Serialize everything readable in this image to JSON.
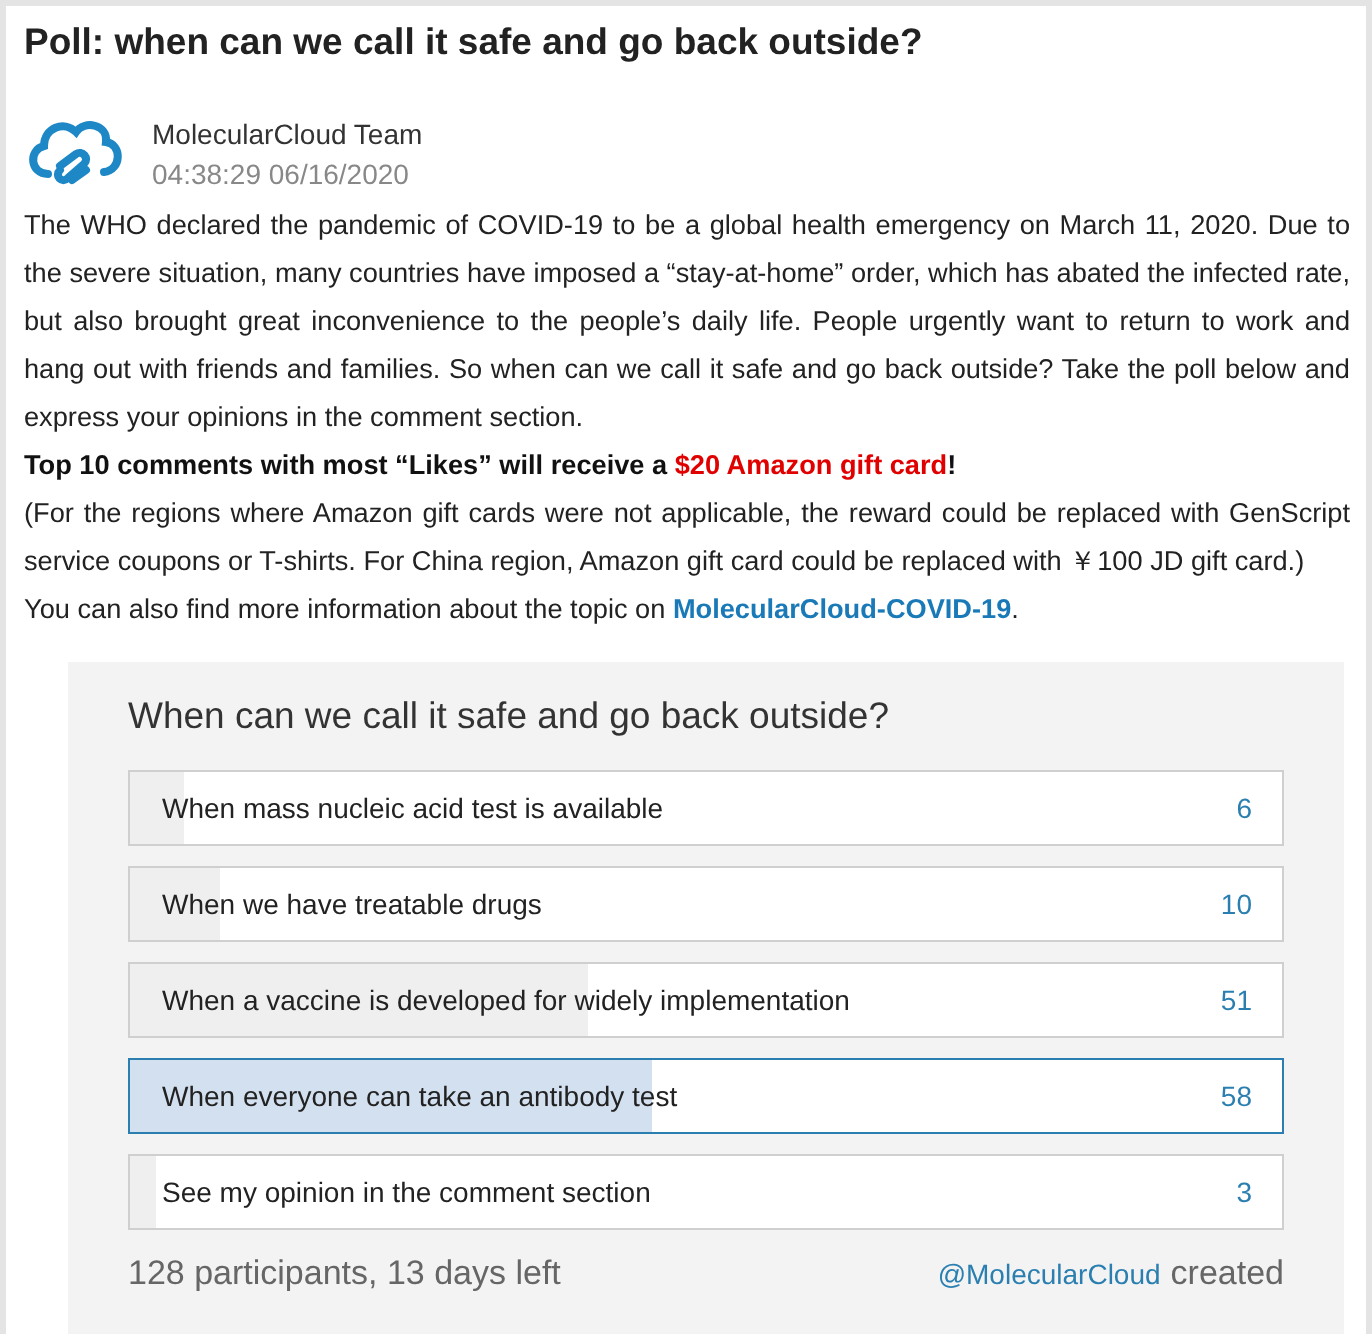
{
  "title": "Poll: when can we call it safe and go back outside?",
  "author": {
    "name": "MolecularCloud Team",
    "time": "04:38:29 06/16/2020"
  },
  "body": "The WHO declared the pandemic of COVID-19 to be a global health emergency on March 11, 2020.  Due to the severe situation, many countries have imposed a “stay-at-home” order, which has abated the infected rate, but also brought great inconvenience to the people’s daily life. People urgently want to return to work and hang out with friends and families. So when can we call it safe and go back outside?  Take the poll below and express your opinions in the comment section.",
  "prize_line": {
    "before": "Top 10 comments with most “Likes” will receive a ",
    "highlight": "$20 Amazon gift card",
    "after": "!"
  },
  "note": "(For the regions where Amazon gift cards were not applicable, the reward could be replaced with GenScript service coupons or T-shirts. For China region, Amazon gift card could be replaced with ￥100 JD gift card.)",
  "more_line": {
    "before": "You can also find more information about the topic on ",
    "link": "MolecularCloud-COVID-19",
    "after": "."
  },
  "poll": {
    "question": "When can we call it safe and go back outside?",
    "options": [
      {
        "label": "When mass nucleic acid test is available",
        "count": "6",
        "level": 0.047,
        "selected": false
      },
      {
        "label": "When we have treatable drugs",
        "count": "10",
        "level": 0.078,
        "selected": false
      },
      {
        "label": "When a vaccine is developed for widely implementation",
        "count": "51",
        "level": 0.398,
        "selected": false
      },
      {
        "label": "When everyone can take an antibody test",
        "count": "58",
        "level": 0.453,
        "selected": true
      },
      {
        "label": "See my opinion in the comment section",
        "count": "3",
        "level": 0.023,
        "selected": false
      }
    ],
    "summary": "128 participants, 13 days left",
    "creator": "@MolecularCloud",
    "created": "created"
  }
}
